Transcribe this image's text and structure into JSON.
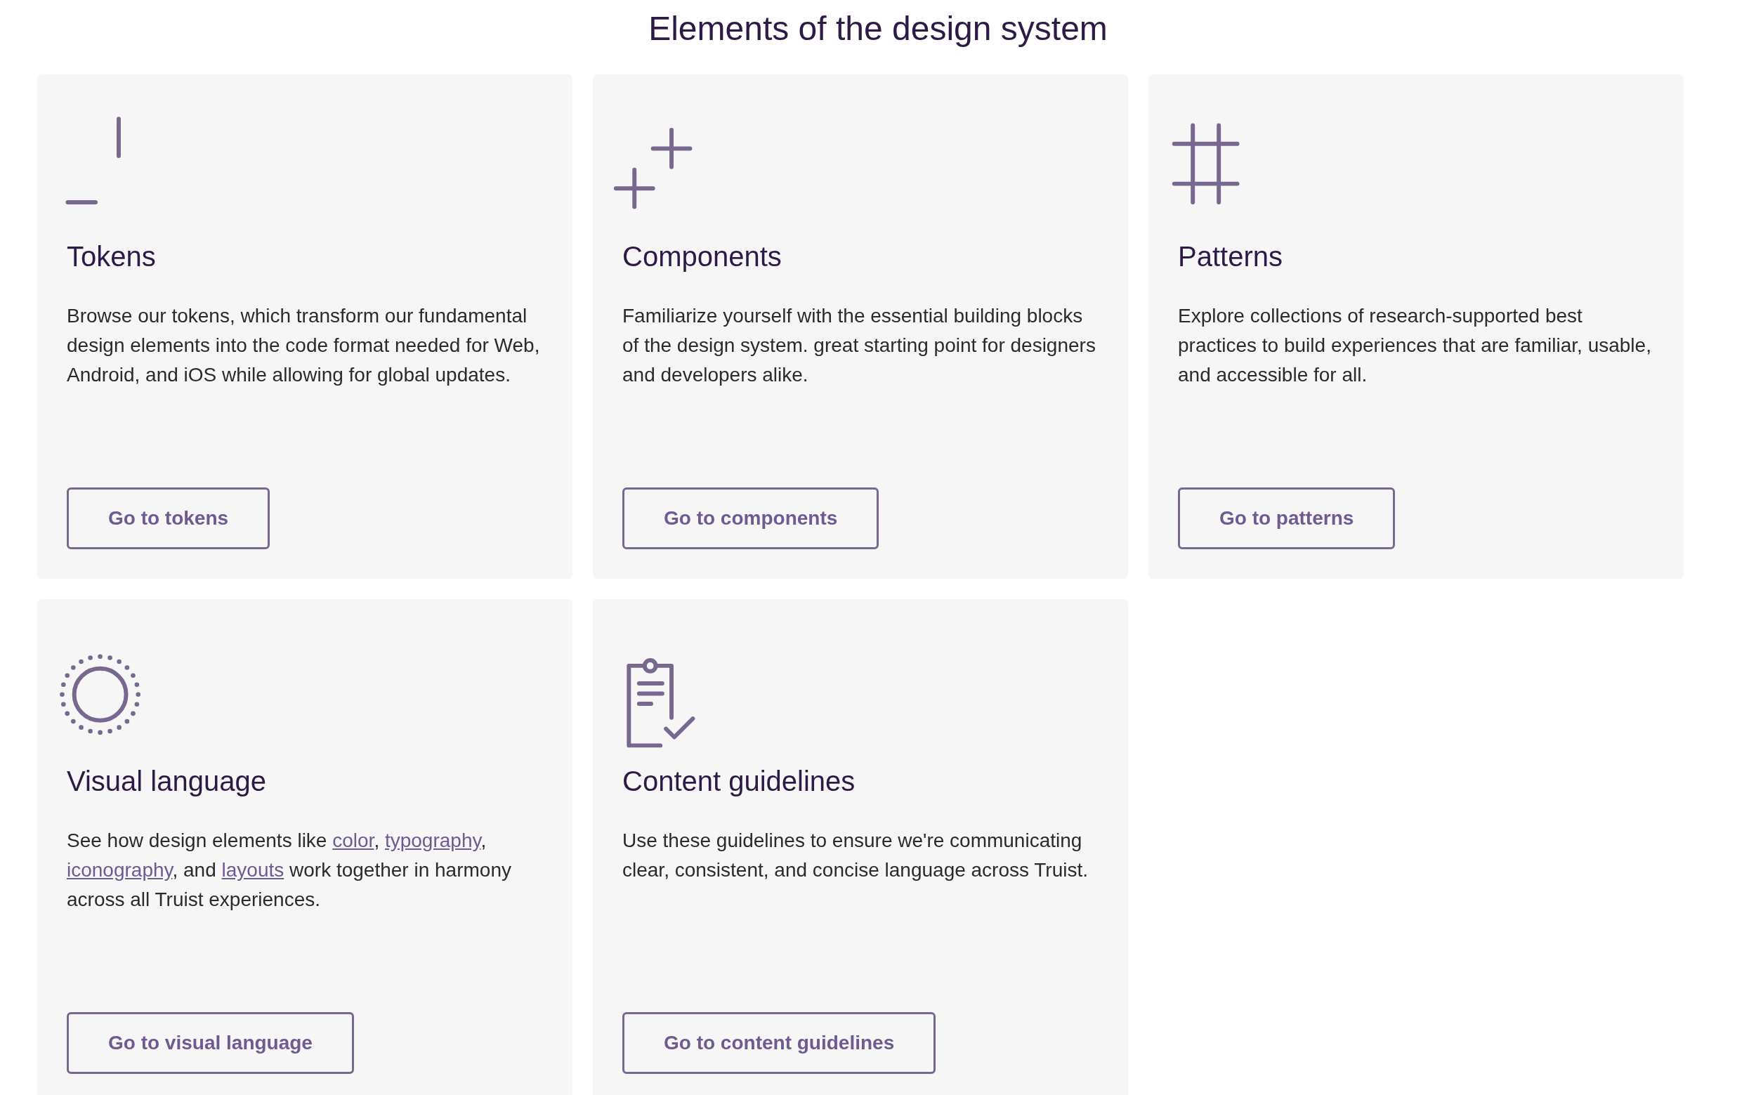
{
  "heading": "Elements of the design system",
  "cards": [
    {
      "title": "Tokens",
      "description": [
        {
          "kind": "text",
          "text": "Browse our tokens, which transform our fundamental design elements into the code format needed for Web, Android, and iOS while allowing for global updates."
        }
      ],
      "button": "Go to tokens"
    },
    {
      "title": "Components",
      "description": [
        {
          "kind": "text",
          "text": "Familiarize yourself with the essential building blocks of the design system. great starting point for designers and developers alike."
        }
      ],
      "button": "Go to components"
    },
    {
      "title": "Patterns",
      "description": [
        {
          "kind": "text",
          "text": "Explore collections of research-supported best practices to build experiences that are familiar, usable, and accessible for all."
        }
      ],
      "button": "Go to patterns"
    },
    {
      "title": "Visual language",
      "description": [
        {
          "kind": "text",
          "text": "See how design elements like "
        },
        {
          "kind": "link",
          "text": "color"
        },
        {
          "kind": "text",
          "text": ", "
        },
        {
          "kind": "link",
          "text": "typography"
        },
        {
          "kind": "text",
          "text": ", "
        },
        {
          "kind": "link",
          "text": "iconography"
        },
        {
          "kind": "text",
          "text": ", and "
        },
        {
          "kind": "link",
          "text": "layouts"
        },
        {
          "kind": "text",
          "text": " work together in harmony across all Truist experiences."
        }
      ],
      "button": "Go to visual language"
    },
    {
      "title": "Content guidelines",
      "description": [
        {
          "kind": "text",
          "text": "Use these guidelines to ensure we're communicating clear, consistent, and concise language across Truist."
        }
      ],
      "button": "Go to content guidelines"
    }
  ]
}
